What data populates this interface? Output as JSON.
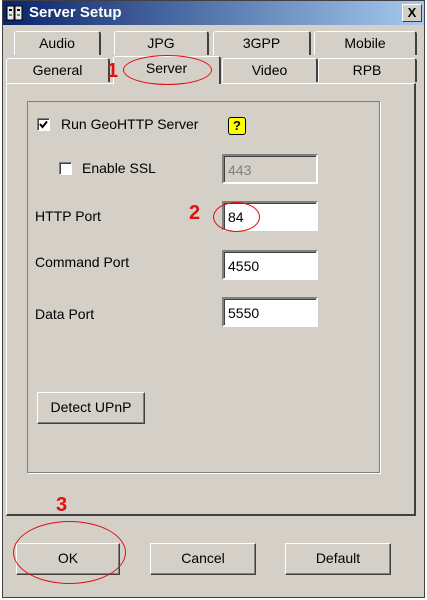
{
  "window": {
    "title": "Server Setup",
    "close_label": "X"
  },
  "tabs_row1": [
    "Audio",
    "JPG",
    "3GPP",
    "Mobile"
  ],
  "tabs_row2": [
    "General",
    "Server",
    "Video",
    "RPB"
  ],
  "active_tab": "Server",
  "server": {
    "run_geohttp_label": "Run GeoHTTP Server",
    "run_geohttp_checked": true,
    "help_label": "?",
    "enable_ssl_label": "Enable SSL",
    "enable_ssl_checked": false,
    "ssl_port": "443",
    "http_port_label": "HTTP Port",
    "http_port": "84",
    "command_port_label": "Command Port",
    "command_port": "4550",
    "data_port_label": "Data Port",
    "data_port": "5550",
    "detect_upnp_label": "Detect UPnP"
  },
  "buttons": {
    "ok": "OK",
    "cancel": "Cancel",
    "default": "Default"
  },
  "annotations": [
    "1",
    "2",
    "3"
  ],
  "colors": {
    "dialog_bg": "#d4d0c8",
    "title_start": "#0a246a",
    "title_end": "#a6caf0",
    "annotation": "#e01010",
    "help_icon": "#ffff00"
  }
}
